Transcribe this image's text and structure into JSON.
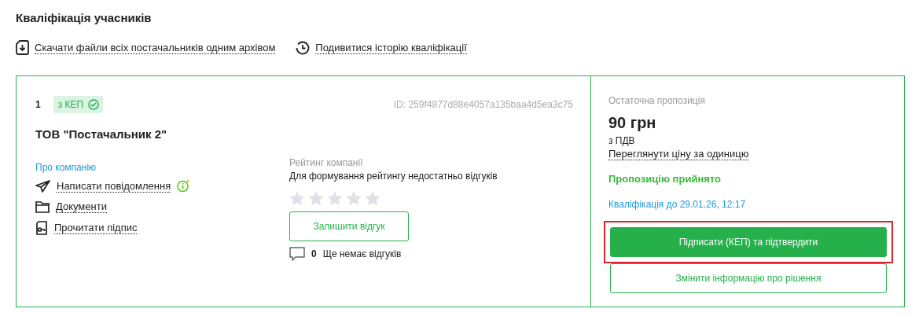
{
  "title": "Кваліфікація учасників",
  "actions": [
    {
      "kind": "download",
      "label": "Скачати файли всіх постачальників одним архівом"
    },
    {
      "kind": "history",
      "label": "Подивитися історію кваліфікації"
    }
  ],
  "bid": {
    "number": "1",
    "badge": "з КЕП",
    "badge_verified": true,
    "id": "ID: 259f4877d88e4057a135baa4d5ea3c75",
    "supplier": "ТОВ \"Постачальник 2\"",
    "about_label": "Про компанію",
    "links": [
      {
        "kind": "message",
        "label": "Написати повідомлення",
        "info": true
      },
      {
        "kind": "documents",
        "label": "Документи",
        "info": false
      },
      {
        "kind": "signature",
        "label": "Прочитати підпис",
        "info": false
      }
    ],
    "rating": {
      "label": "Рейтинг компанії",
      "note": "Для формування рейтингу недостатньо відгуків",
      "stars": 0,
      "review_button": "Залишити відгук",
      "review_count": "0",
      "review_note": "Ще немає відгуків"
    },
    "offer": {
      "label": "Остаточна пропозиція",
      "price": "90 грн",
      "vat": "з ПДВ",
      "unit_link": "Переглянути ціну за одиницю",
      "status": "Пропозицію прийнято",
      "deadline": "Кваліфікація до 29.01.26, 12:17",
      "buttons": [
        {
          "kind": "primary",
          "label": "Підписати (КЕП) та підтвердити",
          "highlighted": true
        },
        {
          "kind": "outline",
          "label": "Змінити інформацію про рішення",
          "highlighted": false
        }
      ]
    }
  }
}
